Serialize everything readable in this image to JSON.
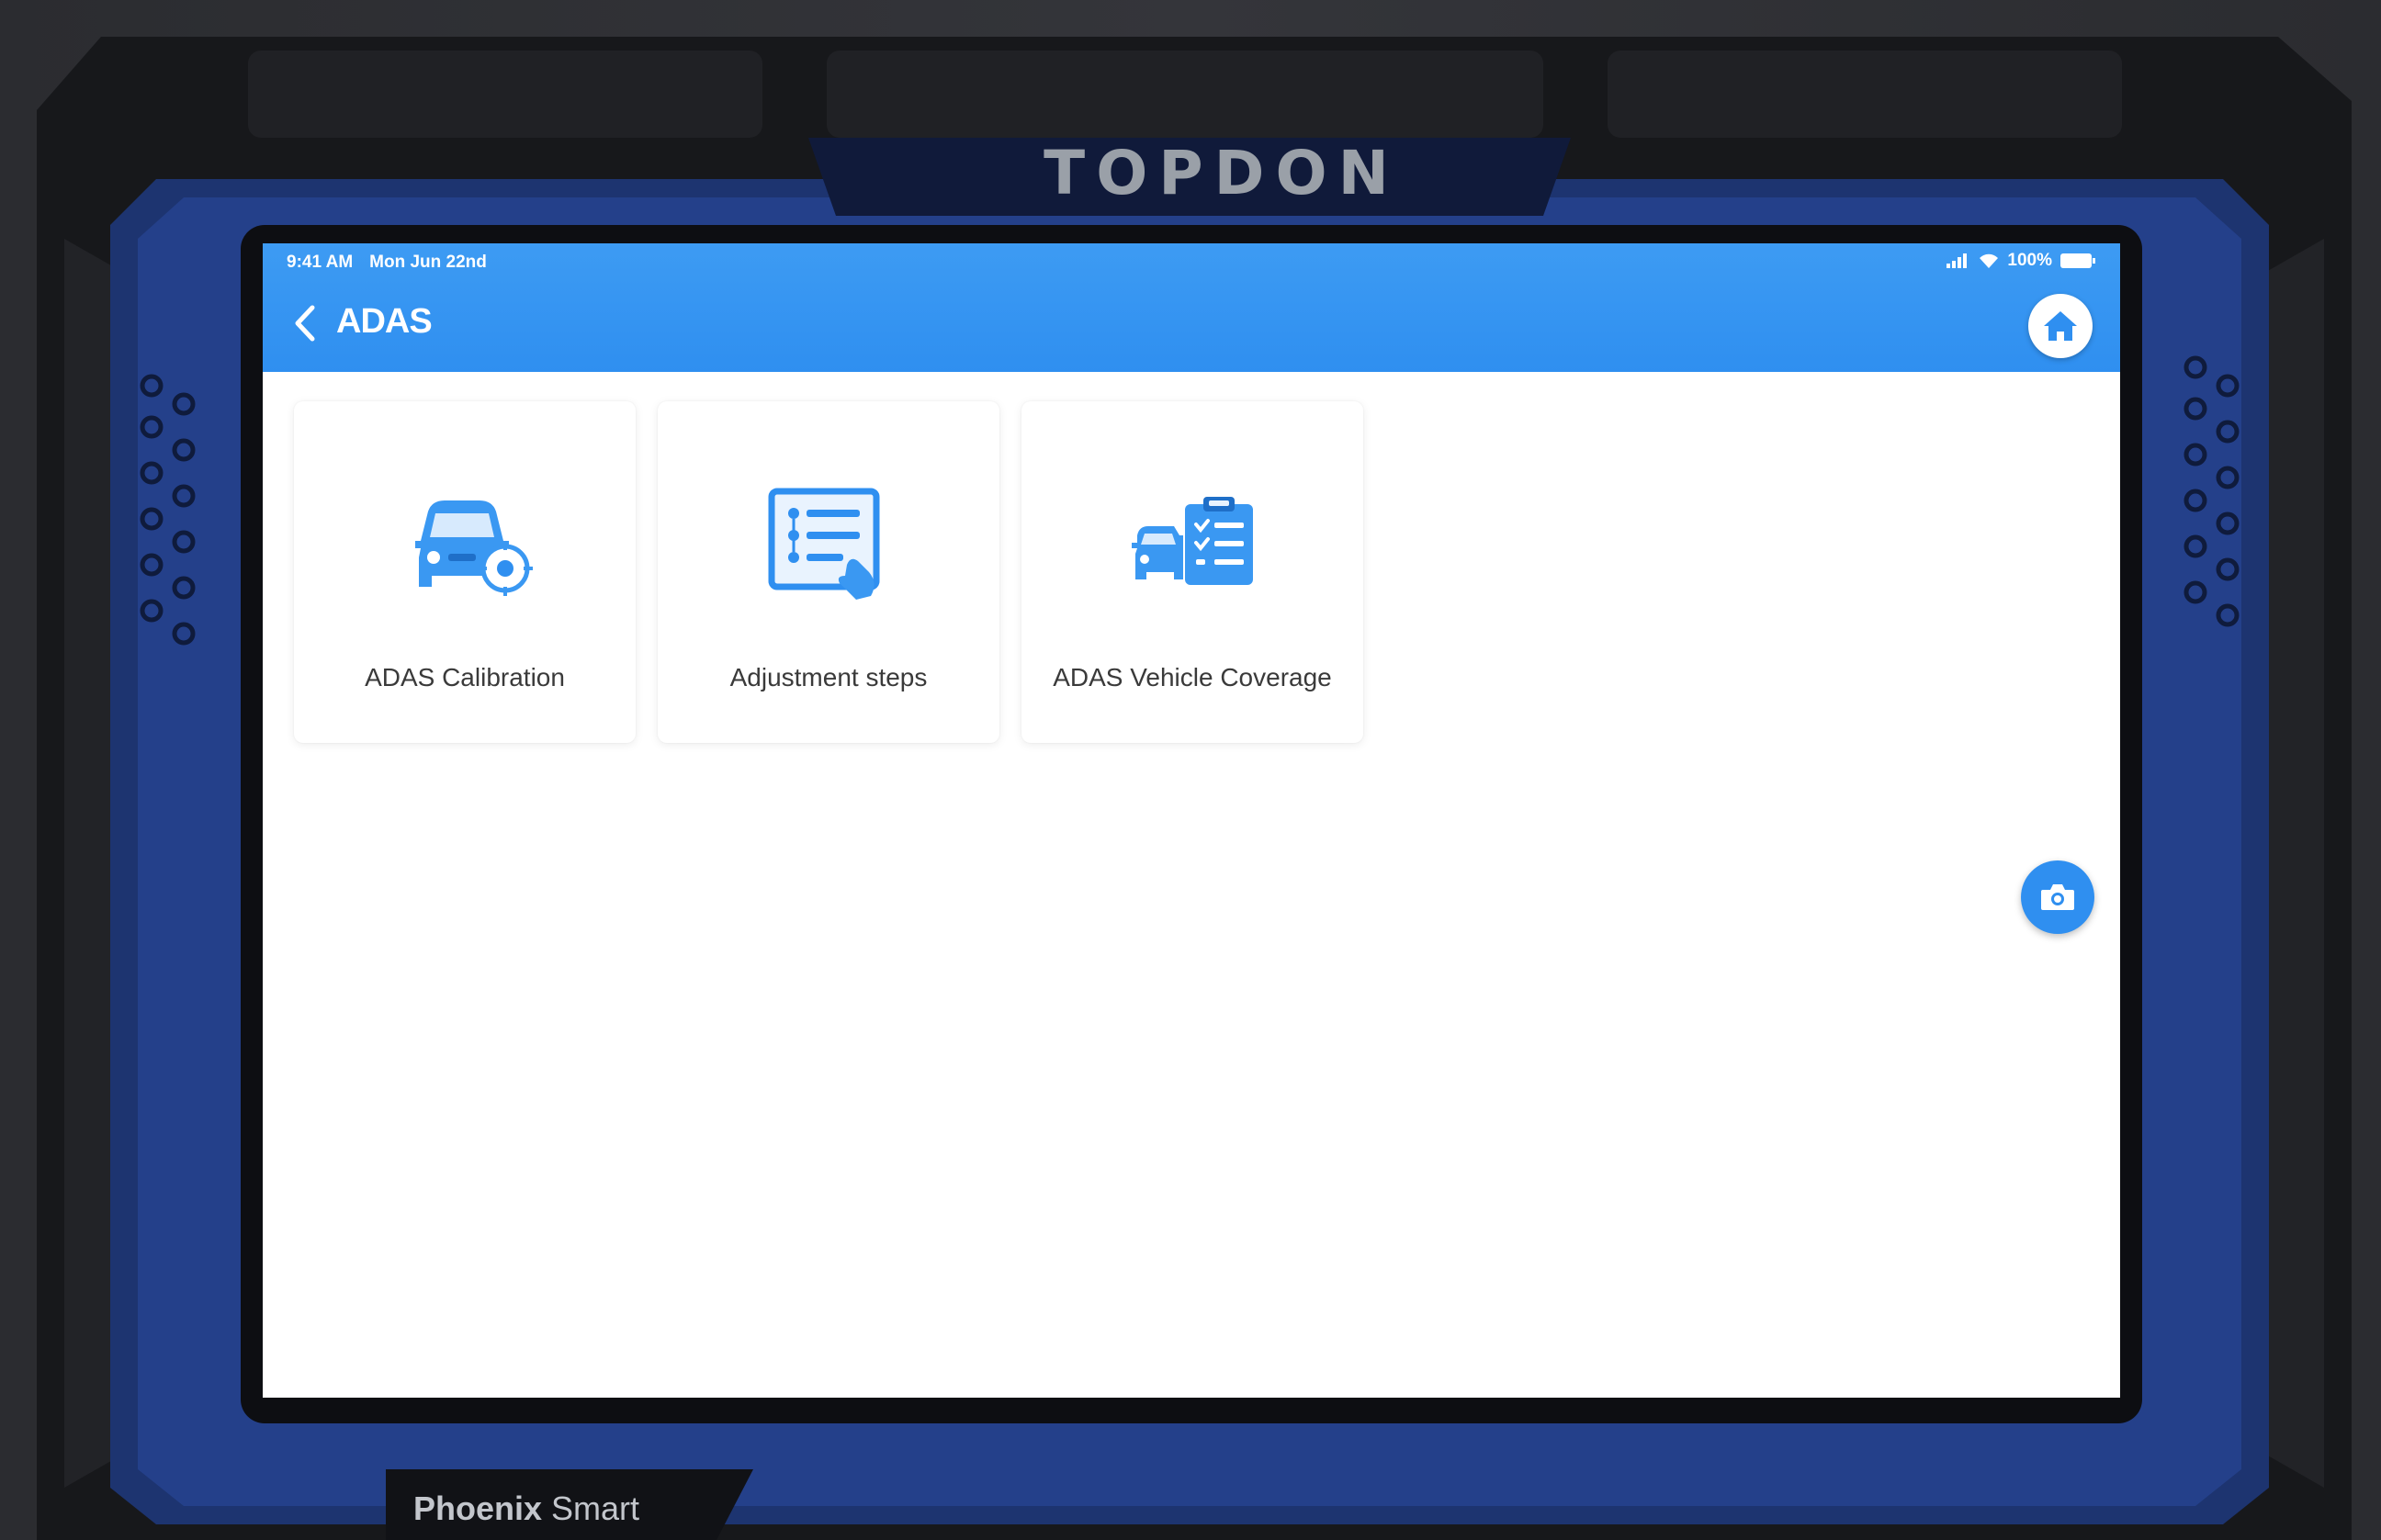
{
  "device": {
    "brand": "TOPDON",
    "model_bold": "Phoenix",
    "model_rest": " Smart"
  },
  "status_bar": {
    "time": "9:41 AM",
    "date": "Mon Jun 22nd",
    "battery": "100%"
  },
  "header": {
    "title": "ADAS",
    "back_icon": "chevron-left-icon",
    "home_icon": "home-icon"
  },
  "tiles": [
    {
      "label": "ADAS Calibration",
      "icon": "car-target-icon"
    },
    {
      "label": "Adjustment steps",
      "icon": "checklist-touch-icon"
    },
    {
      "label": "ADAS Vehicle Coverage",
      "icon": "car-clipboard-icon"
    }
  ],
  "floating": {
    "camera_icon": "camera-icon"
  },
  "colors": {
    "accent": "#2f8ff0",
    "header": "#3d9bf3",
    "frame_blue": "#24408a",
    "frame_black": "#1c1d21"
  }
}
